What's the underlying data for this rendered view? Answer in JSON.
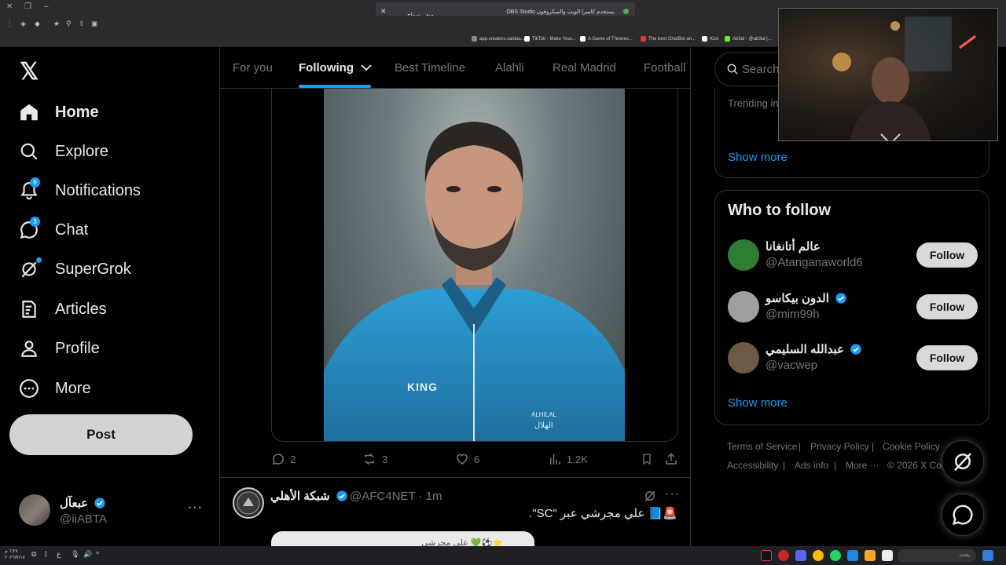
{
  "browser": {
    "obs_notification": "OBS Studio يستخدم كاميرا الويب والميكروفون",
    "obs_btn_stop": "منع",
    "obs_btn_share": "سماح",
    "bookmarks": [
      {
        "label": "app.creators.sa/das...",
        "color": "#888888"
      },
      {
        "label": "TikTok - Make Your...",
        "color": "#ffffff"
      },
      {
        "label": "A Game of Thrones...",
        "color": "#ffffff"
      },
      {
        "label": "The best ChatBot an...",
        "color": "#e53935"
      },
      {
        "label": "Kick",
        "color": "#ffffff"
      },
      {
        "label": "Ab3al - @ab3al |...",
        "color": "#53fc18"
      }
    ]
  },
  "nav": {
    "logo": "𝕏",
    "items": [
      {
        "label": "Home",
        "icon": "home-icon",
        "active": true
      },
      {
        "label": "Explore",
        "icon": "search-icon"
      },
      {
        "label": "Notifications",
        "icon": "bell-icon",
        "badge": "6"
      },
      {
        "label": "Chat",
        "icon": "chat-icon",
        "badge": "3"
      },
      {
        "label": "SuperGrok",
        "icon": "grok-icon",
        "dot": true
      },
      {
        "label": "Articles",
        "icon": "article-icon"
      },
      {
        "label": "Profile",
        "icon": "person-icon"
      },
      {
        "label": "More",
        "icon": "more-circle-icon"
      }
    ],
    "post_label": "Post",
    "account": {
      "name": "عبعآل",
      "handle": "@iiABTA",
      "more": "···"
    }
  },
  "timeline": {
    "tabs": [
      {
        "label": "For you"
      },
      {
        "label": "Following",
        "active": true,
        "dropdown": "⌵"
      },
      {
        "label": "Best Timeline"
      },
      {
        "label": "Alahli"
      },
      {
        "label": "Real Madrid"
      },
      {
        "label": "Football"
      }
    ],
    "photo": {
      "jersey_text": "KING",
      "crest_text": "ALHILAL",
      "crest_arabic": "الهلال"
    },
    "actions": {
      "replies": "2",
      "reposts": "3",
      "likes": "6",
      "views": "1.2K"
    },
    "tweet2": {
      "name": "شبكة الأهلي",
      "handle": "@AFC4NET · 1m",
      "text": "🚨📘 علي مجرشي عبر \"SC\".",
      "card_text": "علي مجرشي 💚⚽⭐"
    }
  },
  "sidebar": {
    "search_placeholder": "Search",
    "trending_label": "Trending in",
    "show_more": "Show more",
    "who_to_follow_title": "Who to follow",
    "who_to_follow": [
      {
        "name": "عالم أتانغانا",
        "handle": "@Atanganaworld6",
        "verified": false,
        "avatar_color": "#2e7d32"
      },
      {
        "name": "الدون بيكاسو",
        "handle": "@mim99h",
        "verified": true,
        "avatar_color": "#9e9e9e"
      },
      {
        "name": "عبدالله السليمي",
        "handle": "@vacwep",
        "verified": true,
        "avatar_color": "#6d5a44"
      }
    ],
    "follow_label": "Follow",
    "show_more_2": "Show more",
    "footer": [
      "Terms of Service",
      "|",
      "Privacy Policy",
      "|",
      "Cookie Policy",
      "Accessibility",
      "|",
      "Ads info",
      "|",
      "More ···",
      "© 2026 X Cor"
    ]
  },
  "taskbar": {
    "time": "٦:٢٧ م",
    "date": "٢٠٢٦/٧/١٧",
    "search_label": "بحث"
  },
  "colors": {
    "accent": "#1d9bf0",
    "background": "#000000",
    "text": "#e7e9ea",
    "muted": "#71767b",
    "border": "#2f3336"
  }
}
